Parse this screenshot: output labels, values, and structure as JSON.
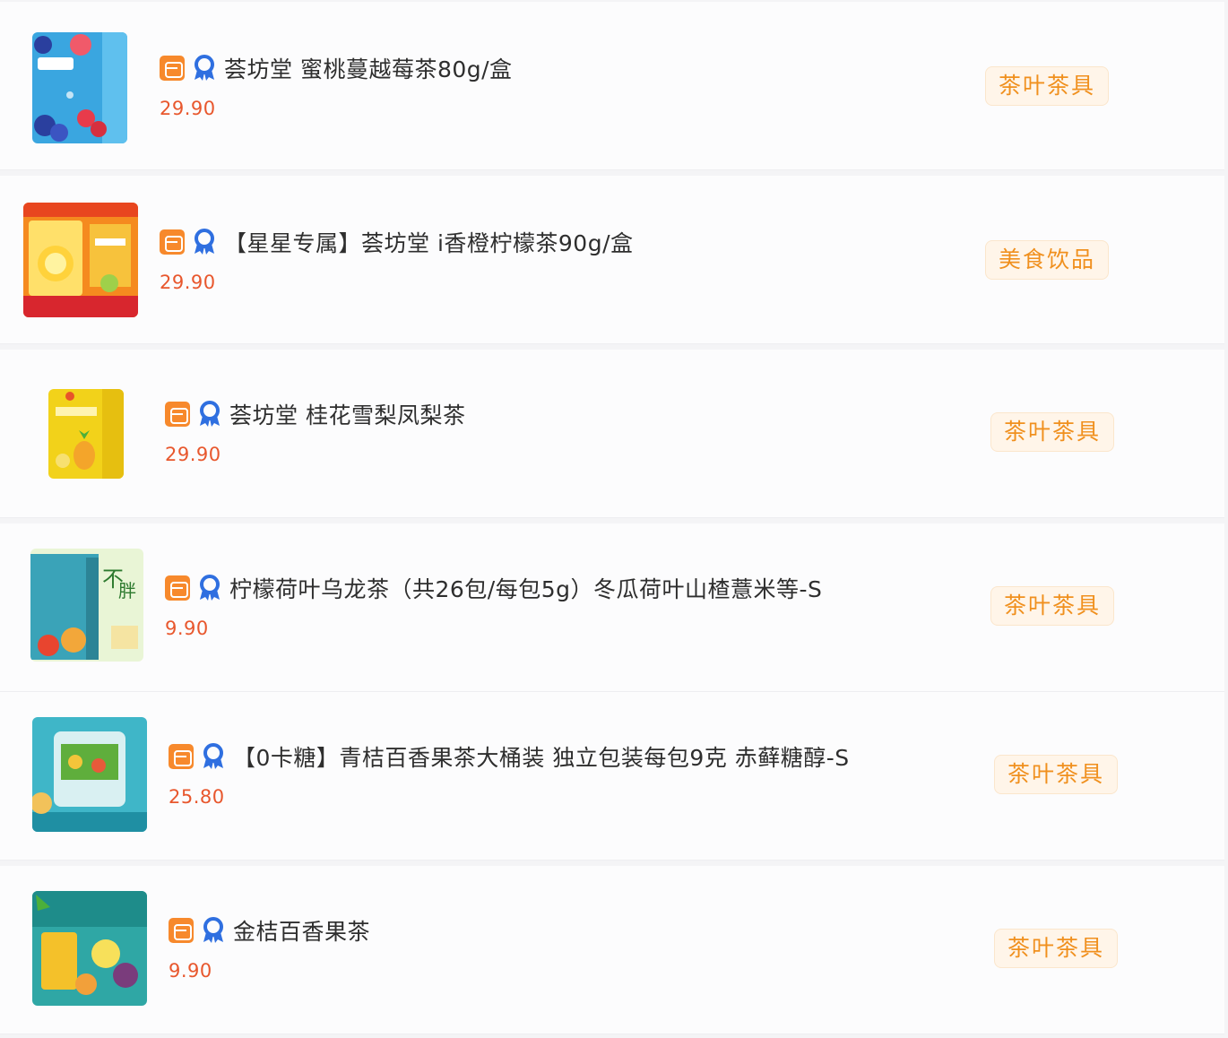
{
  "colors": {
    "price": "#e8572d",
    "tag_text": "#f0901e",
    "tag_bg": "#fff5e9",
    "shop_icon": "#f7892c",
    "badge_icon": "#2f6fe0"
  },
  "items": [
    {
      "title": "荟坊堂 蜜桃蔓越莓茶80g/盒",
      "price": "29.90",
      "tag": "茶叶茶具",
      "icons": [
        "shop-icon",
        "award-badge-icon"
      ]
    },
    {
      "title": "【星星专属】荟坊堂 i香橙柠檬茶90g/盒",
      "price": "29.90",
      "tag": "美食饮品",
      "icons": [
        "shop-icon",
        "award-badge-icon"
      ]
    },
    {
      "title": "荟坊堂 桂花雪梨凤梨茶",
      "price": "29.90",
      "tag": "茶叶茶具",
      "icons": [
        "shop-icon",
        "award-badge-icon"
      ]
    },
    {
      "title": "柠檬荷叶乌龙茶（共26包/每包5g）冬瓜荷叶山楂薏米等-S",
      "price": "9.90",
      "tag": "茶叶茶具",
      "icons": [
        "shop-icon",
        "award-badge-icon"
      ]
    },
    {
      "title": "【0卡糖】青桔百香果茶大桶装 独立包装每包9克 赤藓糖醇-S",
      "price": "25.80",
      "tag": "茶叶茶具",
      "icons": [
        "shop-icon",
        "award-badge-icon"
      ]
    },
    {
      "title": "金桔百香果茶",
      "price": "9.90",
      "tag": "茶叶茶具",
      "icons": [
        "shop-icon",
        "award-badge-icon"
      ]
    }
  ]
}
